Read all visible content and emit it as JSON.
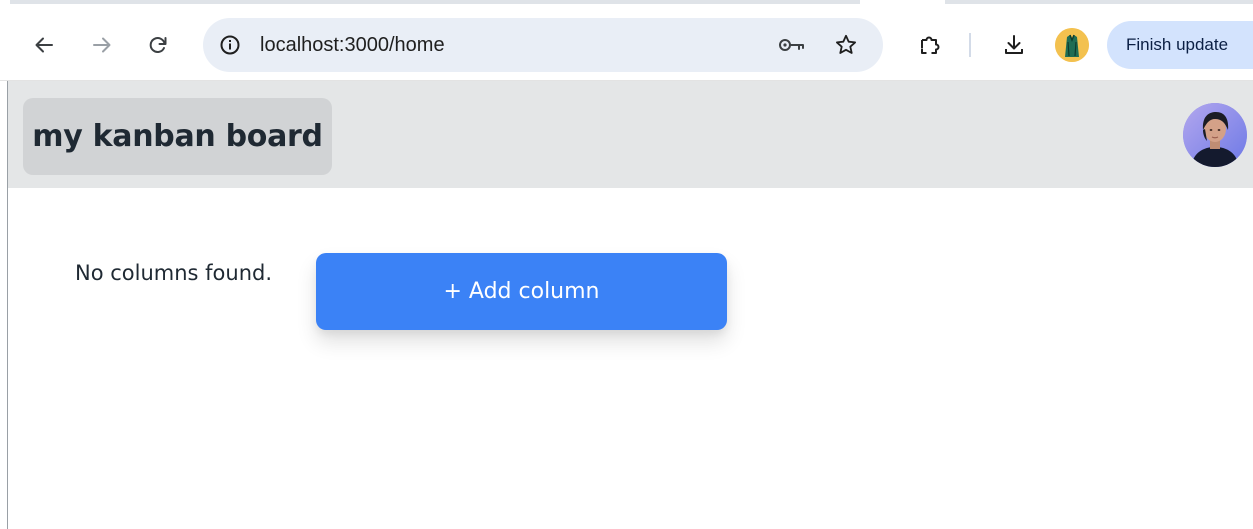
{
  "browser": {
    "url": "localhost:3000/home",
    "update_button_label": "Finish update",
    "icons": {
      "back": "arrow-left-icon",
      "forward": "arrow-right-icon",
      "reload": "reload-icon",
      "site_info": "info-icon",
      "password": "key-icon",
      "bookmark": "star-icon",
      "extensions": "puzzle-icon",
      "downloads": "download-icon"
    }
  },
  "app": {
    "board_title": "my kanban board",
    "empty_message": "No columns found.",
    "add_column_label": "+ Add column"
  },
  "colors": {
    "header_bg": "#e4e6e7",
    "title_button_bg": "#d1d3d5",
    "primary": "#3b82f6",
    "omnibox_bg": "#e9eef6",
    "update_button_bg": "#d3e3fd"
  }
}
